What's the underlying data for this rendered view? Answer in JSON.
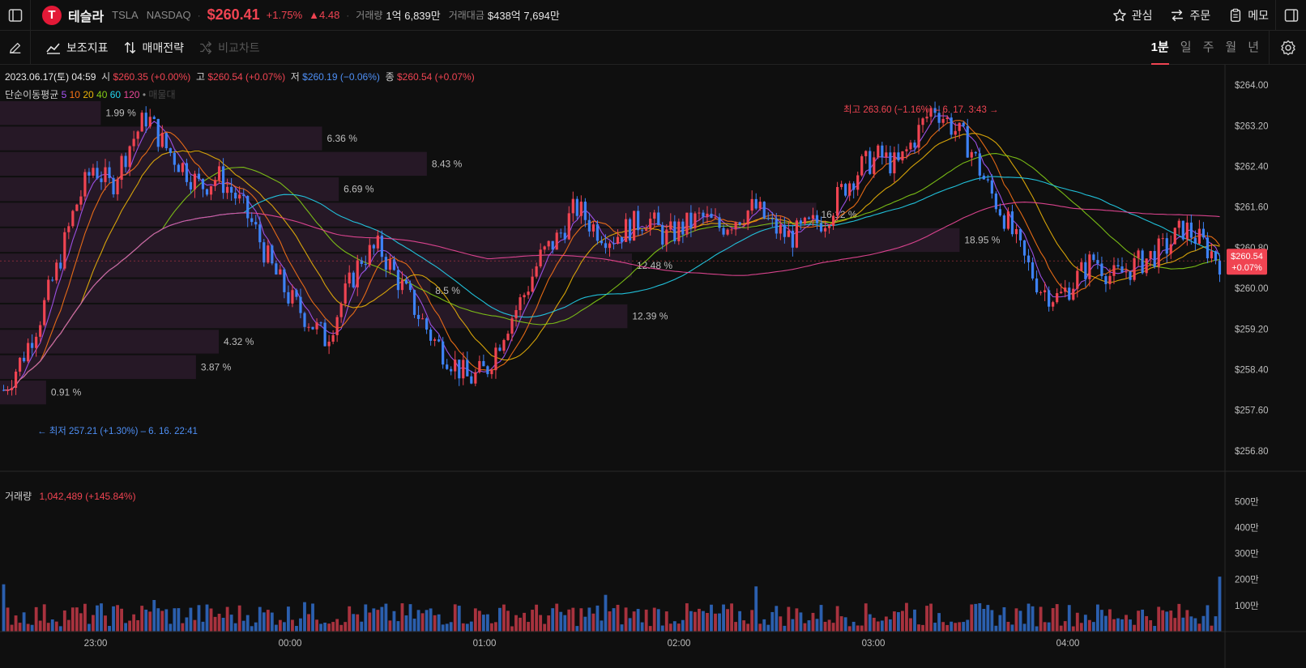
{
  "header": {
    "name": "테슬라",
    "ticker": "TSLA",
    "exchange": "NASDAQ",
    "price": "$260.41",
    "change_pct": "+1.75%",
    "change_abs": "▲4.48",
    "volume_label": "거래량",
    "volume_value": "1억 6,839만",
    "amount_label": "거래대금",
    "amount_value": "$438억 7,694만",
    "actions": [
      "관심",
      "주문",
      "메모"
    ]
  },
  "toolbar": {
    "indicators": "보조지표",
    "strategy": "매매전략",
    "compare": "비교차트",
    "periods": [
      "1분",
      "일",
      "주",
      "월",
      "년"
    ],
    "active_period": "1분"
  },
  "ohlc": {
    "datetime": "2023.06.17(토) 04:59",
    "open_label": "시",
    "open": "$260.35 (+0.00%)",
    "high_label": "고",
    "high": "$260.54 (+0.07%)",
    "low_label": "저",
    "low": "$260.19 (−0.06%)",
    "close_label": "종",
    "close": "$260.54 (+0.07%)"
  },
  "moving_average": {
    "label": "단순이동평균",
    "periods": [
      "5",
      "10",
      "20",
      "40",
      "60",
      "120"
    ],
    "extra": "매물대",
    "colors": [
      "#a855f7",
      "#f97316",
      "#eab308",
      "#84cc16",
      "#22d3ee",
      "#ec4899"
    ]
  },
  "annotations": {
    "high": "최고 263.60 (−1.16%) – 6. 17. 3:43 →",
    "low": "← 최저 257.21 (+1.30%) – 6. 16. 22:41"
  },
  "volume": {
    "label": "거래량",
    "value": "1,042,489 (+145.84%)"
  },
  "price_tag": {
    "price": "$260.54",
    "change": "+0.07%"
  },
  "colors": {
    "up": "#f04452",
    "down": "#3d82f5",
    "bg": "#0f0f0f",
    "profile": "#2a1a2a"
  },
  "chart_data": {
    "type": "candlestick",
    "price_axis": [
      "$264.00",
      "$263.20",
      "$262.40",
      "$261.60",
      "$260.80",
      "$260.00",
      "$259.20",
      "$258.40",
      "$257.60",
      "$256.80"
    ],
    "price_ticks": [
      264.0,
      263.2,
      262.4,
      261.6,
      260.8,
      260.0,
      259.2,
      258.4,
      257.6,
      256.8
    ],
    "ylim": [
      256.4,
      264.4
    ],
    "volume_axis": [
      "500만",
      "400만",
      "300만",
      "200만",
      "100만"
    ],
    "volume_ticks": [
      5000000,
      4000000,
      3000000,
      2000000,
      1000000
    ],
    "x_axis": [
      "23:00",
      "00:00",
      "01:00",
      "02:00",
      "03:00",
      "04:00"
    ],
    "close_path": [
      258.0,
      258.6,
      259.4,
      260.4,
      261.6,
      262.4,
      262.0,
      262.8,
      263.4,
      262.8,
      262.4,
      262.0,
      262.2,
      261.8,
      261.2,
      260.4,
      259.8,
      259.4,
      259.0,
      259.8,
      260.6,
      260.8,
      260.2,
      259.6,
      259.0,
      258.6,
      258.2,
      258.4,
      259.2,
      259.8,
      260.6,
      261.0,
      261.6,
      261.2,
      261.0,
      261.2,
      261.4,
      261.0,
      261.2,
      261.4,
      261.2,
      261.4,
      261.6,
      261.2,
      261.0,
      261.2,
      261.4,
      262.0,
      262.4,
      262.6,
      262.4,
      263.0,
      263.6,
      263.2,
      262.8,
      262.0,
      261.4,
      260.6,
      260.0,
      259.8,
      260.2,
      260.6,
      260.2,
      260.4,
      260.6,
      260.8,
      261.2,
      260.9,
      260.54
    ],
    "volume_profile": [
      {
        "range": [
          263.2,
          263.7
        ],
        "pct": 1.99
      },
      {
        "range": [
          262.7,
          263.2
        ],
        "pct": 6.36
      },
      {
        "range": [
          262.2,
          262.7
        ],
        "pct": 8.43
      },
      {
        "range": [
          261.7,
          262.2
        ],
        "pct": 6.69
      },
      {
        "range": [
          261.2,
          261.7
        ],
        "pct": 16.12
      },
      {
        "range": [
          260.7,
          261.2
        ],
        "pct": 18.95
      },
      {
        "range": [
          260.2,
          260.7
        ],
        "pct": 12.48
      },
      {
        "range": [
          259.7,
          260.2
        ],
        "pct": 8.5
      },
      {
        "range": [
          259.2,
          259.7
        ],
        "pct": 12.39
      },
      {
        "range": [
          258.7,
          259.2
        ],
        "pct": 4.32
      },
      {
        "range": [
          258.2,
          258.7
        ],
        "pct": 3.87
      },
      {
        "range": [
          257.7,
          258.2
        ],
        "pct": 0.91
      }
    ],
    "profile_labels": [
      "1.99 %",
      "6.36 %",
      "8.43 %",
      "6.69 %",
      "16.12 %",
      "18.95 %",
      "12.48 %",
      "8.5 %",
      "12.39 %",
      "4.32 %",
      "3.87 %",
      "0.91 %"
    ]
  }
}
